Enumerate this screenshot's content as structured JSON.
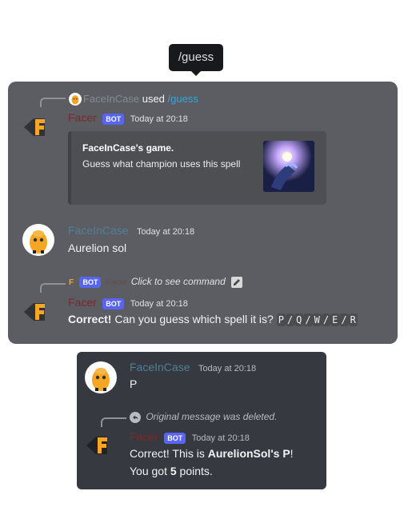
{
  "tooltip": {
    "text": "/guess"
  },
  "panel1": {
    "reply1": {
      "user": "FaceInCase",
      "used": "used",
      "command": "/guess"
    },
    "msg1": {
      "author": "Facer",
      "badge": "BOT",
      "timestamp": "Today at 20:18",
      "embed": {
        "title": "FaceInCase's game.",
        "description": "Guess what champion uses this spell"
      }
    },
    "msg2": {
      "author": "FaceInCase",
      "timestamp": "Today at 20:18",
      "text": "Aurelion sol"
    },
    "reply2": {
      "badge": "BOT",
      "author": "Facer",
      "hint": "Click to see command"
    },
    "msg3": {
      "author": "Facer",
      "badge": "BOT",
      "timestamp": "Today at 20:18",
      "bold": "Correct!",
      "text": " Can you guess which spell it is? ",
      "options": [
        "P",
        "Q",
        "W",
        "E",
        "R"
      ],
      "separator": "/"
    }
  },
  "panel2": {
    "msg1": {
      "author": "FaceInCase",
      "timestamp": "Today at 20:18",
      "text": "P"
    },
    "reply": {
      "text": "Original message was deleted."
    },
    "msg2": {
      "author": "Facer",
      "badge": "BOT",
      "timestamp": "Today at 20:18",
      "line1_pre": "Correct! This is ",
      "line1_bold": "AurelionSol's P",
      "line1_post": "!",
      "line2_pre": "You got ",
      "line2_bold": "5",
      "line2_post": " points."
    }
  },
  "colors": {
    "panel_light": "#5b5d62",
    "panel_dark": "#36393f",
    "bot_badge": "#5865f2",
    "facer_name": "#7a2a2a",
    "user_name": "#4f7f9a",
    "f_logo": "#f6a623"
  },
  "icons": [
    "f-logo-icon",
    "user-avatar-icon",
    "reply-arrow-icon",
    "edit-icon",
    "spell-thumbnail"
  ]
}
